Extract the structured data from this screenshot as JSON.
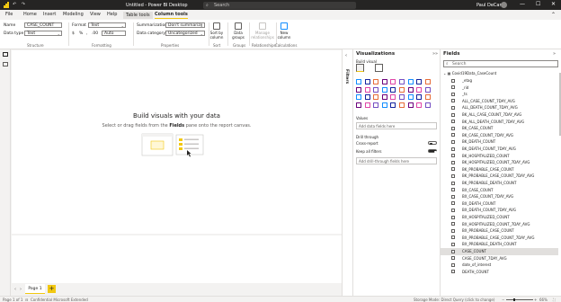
{
  "titlebar": {
    "title": "Untitled - Power BI Desktop",
    "search_placeholder": "Search",
    "user_name": "Paul DeCarlo",
    "quick_access": "↶ ↷",
    "minimize": "—",
    "maximize": "☐",
    "close": "✕"
  },
  "tabs": [
    {
      "label": "File"
    },
    {
      "label": "Home"
    },
    {
      "label": "Insert"
    },
    {
      "label": "Modeling"
    },
    {
      "label": "View"
    },
    {
      "label": "Help"
    },
    {
      "label": "Table tools"
    },
    {
      "label": "Column tools"
    }
  ],
  "ribbon": {
    "name_label": "Name",
    "name_value": "CASE_COUNT",
    "datatype_label": "Data type",
    "datatype_value": "Text",
    "structure_label": "Structure",
    "format_label": "Format",
    "format_value": "Text",
    "currency_symbol": "$",
    "percent_symbol": "%",
    "comma_symbol": ",",
    "decimal_symbol": ".00",
    "auto_label": "Auto",
    "formatting_label": "Formatting",
    "summarization_label": "Summarization",
    "summarization_value": "Don't summarize",
    "category_label": "Data category",
    "category_value": "Uncategorized",
    "properties_label": "Properties",
    "sort_label": "Sort by column",
    "sort_group": "Sort",
    "groups_label": "Data groups",
    "groups_group": "Groups",
    "relationships_label": "Manage relationships",
    "relationships_group": "Relationships",
    "newcolumn_label": "New column",
    "calculations_group": "Calculations"
  },
  "canvas": {
    "heading": "Build visuals with your data",
    "sub_before": "Select or drag fields from the",
    "sub_bold": "Fields",
    "sub_after": "pane onto the report canvas."
  },
  "pages": {
    "tab": "Page 1",
    "add": "+"
  },
  "status": {
    "page_info": "Page 1 of 1",
    "sensitivity": "Confidential Microsoft Extended",
    "storage": "Storage Mode: Direct Query (click to change)",
    "zoom": "66%"
  },
  "filters": {
    "label": "Filters"
  },
  "viz": {
    "title": "Visualizations",
    "build_visual": "Build visual",
    "values_label": "Values",
    "values_placeholder": "Add data fields here",
    "drillthrough_label": "Drill through",
    "cross_report_label": "Cross-report",
    "cross_report_state": "Off",
    "keep_filters_label": "Keep all filters",
    "keep_filters_state": "On",
    "drill_placeholder": "Add drill-through fields here",
    "icon_count": 36
  },
  "fields": {
    "title": "Fields",
    "search_placeholder": "Search",
    "table_name": "Covid19Data_CaseCount",
    "items": [
      "_etag",
      "_rid",
      "_ts",
      "ALL_CASE_COUNT_7DAY_AVG",
      "ALL_DEATH_COUNT_7DAY_AVG",
      "BK_ALL_CASE_COUNT_7DAY_AVG",
      "BK_ALL_DEATH_COUNT_7DAY_AVG",
      "BK_CASE_COUNT",
      "BK_CASE_COUNT_7DAY_AVG",
      "BK_DEATH_COUNT",
      "BK_DEATH_COUNT_7DAY_AVG",
      "BK_HOSPITALIZED_COUNT",
      "BK_HOSPITALIZED_COUNT_7DAY_AVG",
      "BK_PROBABLE_CASE_COUNT",
      "BK_PROBABLE_CASE_COUNT_7DAY_AVG",
      "BK_PROBABLE_DEATH_COUNT",
      "BX_CASE_COUNT",
      "BX_CASE_COUNT_7DAY_AVG",
      "BX_DEATH_COUNT",
      "BX_DEATH_COUNT_7DAY_AVG",
      "BX_HOSPITALIZED_COUNT",
      "BX_HOSPITALIZED_COUNT_7DAY_AVG",
      "BX_PROBABLE_CASE_COUNT",
      "BX_PROBABLE_CASE_COUNT_7DAY_AVG",
      "BX_PROBABLE_DEATH_COUNT",
      "CASE_COUNT",
      "CASE_COUNT_7DAY_AVG",
      "date_of_interest",
      "DEATH_COUNT"
    ],
    "highlighted_item": "CASE_COUNT"
  },
  "colors": {
    "accent": "#f2c811",
    "titlebar": "#252423",
    "pane_bg": "#ffffff",
    "chrome_bg": "#f3f2f1"
  }
}
